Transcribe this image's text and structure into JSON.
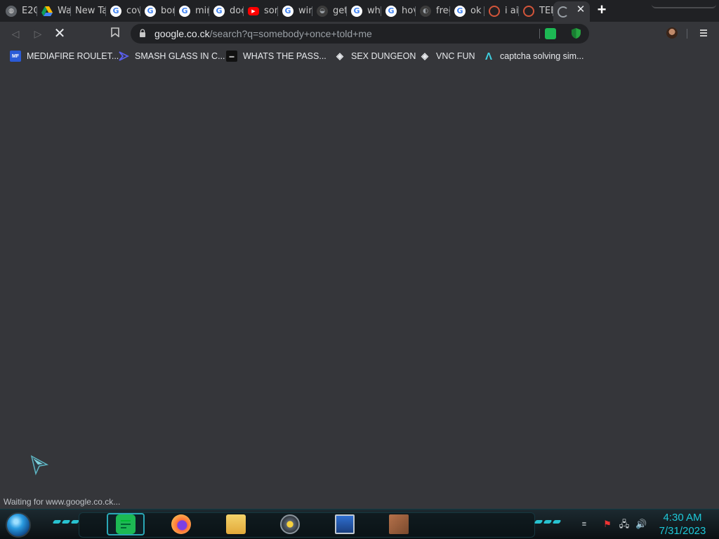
{
  "tabs": [
    {
      "label": "E2C",
      "favicon": "globe-icon"
    },
    {
      "label": "Wa",
      "favicon": "google-drive-icon"
    },
    {
      "label": "New Ta",
      "favicon": "none"
    },
    {
      "label": "cov",
      "favicon": "google-icon"
    },
    {
      "label": "bor",
      "favicon": "google-icon"
    },
    {
      "label": "min",
      "favicon": "google-icon"
    },
    {
      "label": "doc",
      "favicon": "google-icon"
    },
    {
      "label": "son",
      "favicon": "youtube-icon"
    },
    {
      "label": "win",
      "favicon": "google-icon"
    },
    {
      "label": "get",
      "favicon": "generic-site-icon"
    },
    {
      "label": "wha",
      "favicon": "google-icon"
    },
    {
      "label": "hov",
      "favicon": "google-icon"
    },
    {
      "label": "free",
      "favicon": "generic-site-icon"
    },
    {
      "label": "ok",
      "favicon": "google-icon"
    },
    {
      "label": "i ai",
      "favicon": "swirl-icon"
    },
    {
      "label": "TEE",
      "favicon": "swirl-icon"
    },
    {
      "label": "",
      "favicon": "loading-spinner-icon"
    }
  ],
  "toolbar": {
    "url_host": "google.co.ck",
    "url_path": "/search?q=somebody+once+told+me"
  },
  "bookmarks": [
    {
      "label": "MEDIAFIRE ROULET...",
      "icon": "mediafire-icon"
    },
    {
      "label": "SMASH GLASS IN C...",
      "icon": "chevron-logo-icon"
    },
    {
      "label": "WHATS THE PASS...",
      "icon": "dark-square-icon"
    },
    {
      "label": "SEX DUNGEON",
      "icon": "cube-icon"
    },
    {
      "label": "VNC FUN",
      "icon": "cube-icon"
    },
    {
      "label": "captcha solving sim...",
      "icon": "lambda-icon"
    }
  ],
  "status": "Waiting for www.google.co.ck...",
  "clock": {
    "time": "4:30 AM",
    "date": "7/31/2023"
  },
  "colors": {
    "accent": "#1ec8d8",
    "tab_bar": "#202124",
    "page_bg": "#35363a"
  }
}
